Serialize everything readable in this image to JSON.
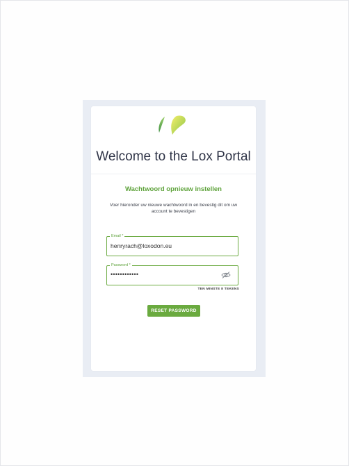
{
  "brand": {
    "logo_icon": "leaf-logo-icon",
    "colors": {
      "leaf_green": "#6aaa3f",
      "leaf_yellow": "#e8e35a",
      "accent": "#5fa33c"
    }
  },
  "header": {
    "title": "Welcome to the Lox Portal"
  },
  "form": {
    "subtitle": "Wachtwoord opnieuw instellen",
    "instructions": "Voer hieronder uw nieuwe wachtwoord in en bevestig dit om uw account te bevestigen",
    "email": {
      "label": "Email *",
      "value": "henryrach@loxodon.eu"
    },
    "password": {
      "label": "Password *",
      "value": "••••••••••••",
      "toggle_icon": "eye-slash-icon"
    },
    "password_hint": "TEN MINSTE 8 TEKENS",
    "submit_label": "RESET PASSWORD"
  }
}
